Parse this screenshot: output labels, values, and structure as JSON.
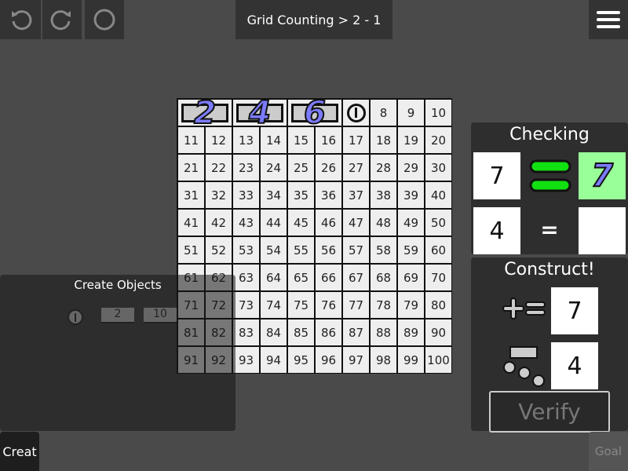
{
  "toolbar": {
    "title": "Grid Counting > 2 - 1"
  },
  "grid": {
    "top_row": [
      {
        "type": "bar",
        "value": "2"
      },
      {
        "type": "bar",
        "value": "4"
      },
      {
        "type": "bar",
        "value": "6"
      },
      {
        "type": "circle"
      },
      {
        "type": "cell",
        "value": "8"
      },
      {
        "type": "cell",
        "value": "9"
      },
      {
        "type": "cell",
        "value": "10"
      }
    ],
    "start": 11,
    "end": 100
  },
  "create_objects": {
    "title": "Create Objects",
    "field1": "2",
    "field2": "10"
  },
  "checking": {
    "title": "Checking",
    "row1_left": "7",
    "row1_right": "7",
    "row2_left": "4",
    "row2_eq": "=",
    "row2_right": ""
  },
  "construct": {
    "title": "Construct!",
    "sum_value": "7",
    "group_value": "4",
    "verify": "Verify"
  },
  "bottom": {
    "create_tab": "Creat",
    "goal_tab": "Goal"
  },
  "colors": {
    "accent_handwriting": "#7b7bff",
    "match_green": "#99ff99"
  }
}
